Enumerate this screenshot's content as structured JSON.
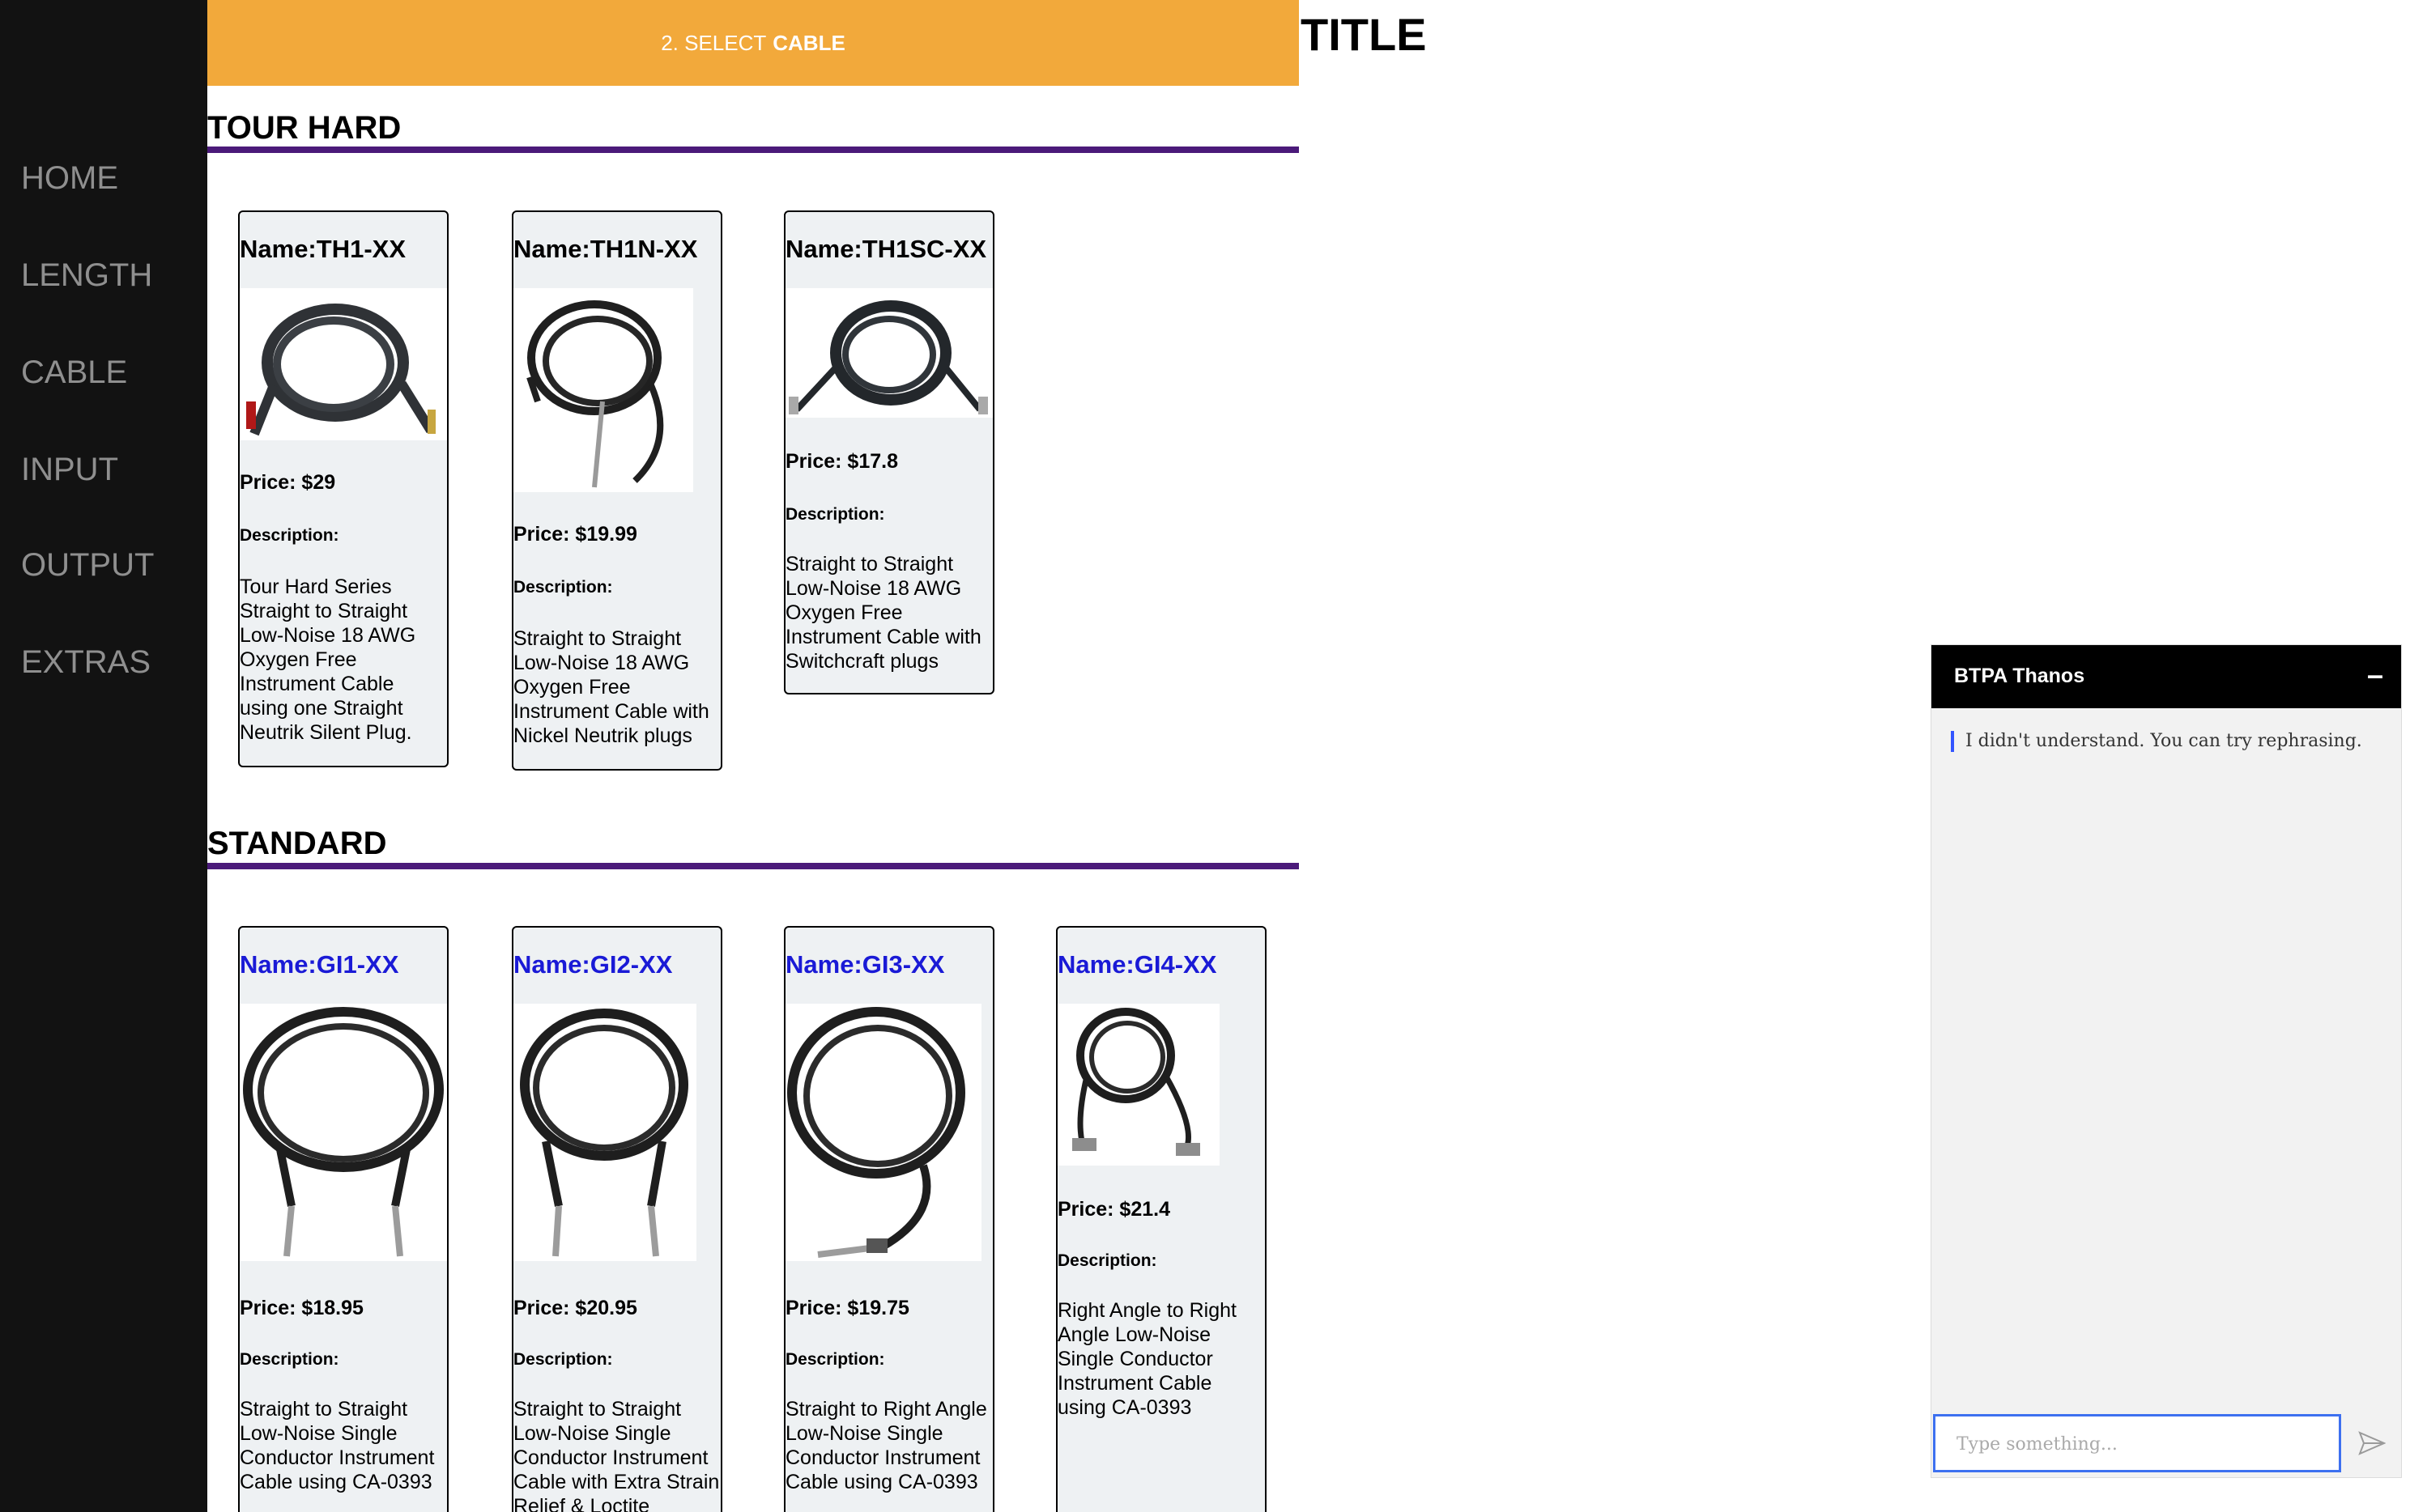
{
  "nav": {
    "items": [
      {
        "label": "HOME"
      },
      {
        "label": "LENGTH"
      },
      {
        "label": "CABLE"
      },
      {
        "label": "INPUT"
      },
      {
        "label": "OUTPUT"
      },
      {
        "label": "EXTRAS"
      }
    ]
  },
  "banner": {
    "prefix": "2. SELECT",
    "emphasis": "CABLE"
  },
  "page_title": "TITLE",
  "sections": [
    {
      "heading": "TOUR HARD",
      "products": [
        {
          "name": "Name:TH1-XX",
          "price": "Price: $29",
          "desc_label": "Description:",
          "desc": "Tour Hard Series Straight to Straight Low-Noise 18 AWG Oxygen Free Instrument Cable using one Straight Neutrik Silent Plug."
        },
        {
          "name": "Name:TH1N-XX",
          "price": "Price: $19.99",
          "desc_label": "Description:",
          "desc": "Straight to Straight Low-Noise 18 AWG Oxygen Free Instrument Cable with Nickel Neutrik plugs"
        },
        {
          "name": "Name:TH1SC-XX",
          "price": "Price: $17.8",
          "desc_label": "Description:",
          "desc": "Straight to Straight Low-Noise 18 AWG Oxygen Free Instrument Cable with Switchcraft plugs"
        }
      ]
    },
    {
      "heading": "STANDARD",
      "products": [
        {
          "name": "Name:GI1-XX",
          "price": "Price: $18.95",
          "desc_label": "Description:",
          "desc": "Straight to Straight Low-Noise Single Conductor Instrument Cable using CA-0393"
        },
        {
          "name": "Name:GI2-XX",
          "price": "Price: $20.95",
          "desc_label": "Description:",
          "desc": "Straight to Straight Low-Noise Single Conductor Instrument Cable with Extra Strain Relief & Loctite"
        },
        {
          "name": "Name:GI3-XX",
          "price": "Price: $19.75",
          "desc_label": "Description:",
          "desc": "Straight to Right Angle Low-Noise Single Conductor Instrument Cable using CA-0393"
        },
        {
          "name": "Name:GI4-XX",
          "price": "Price: $21.4",
          "desc_label": "Description:",
          "desc": "Right Angle to Right Angle Low-Noise Single Conductor Instrument Cable using CA-0393"
        }
      ]
    }
  ],
  "chat": {
    "title": "BTPA Thanos",
    "minimize_symbol": "–",
    "message": "I didn't understand. You can try rephrasing.",
    "input_placeholder": "Type something...",
    "send_icon": "send-icon"
  }
}
